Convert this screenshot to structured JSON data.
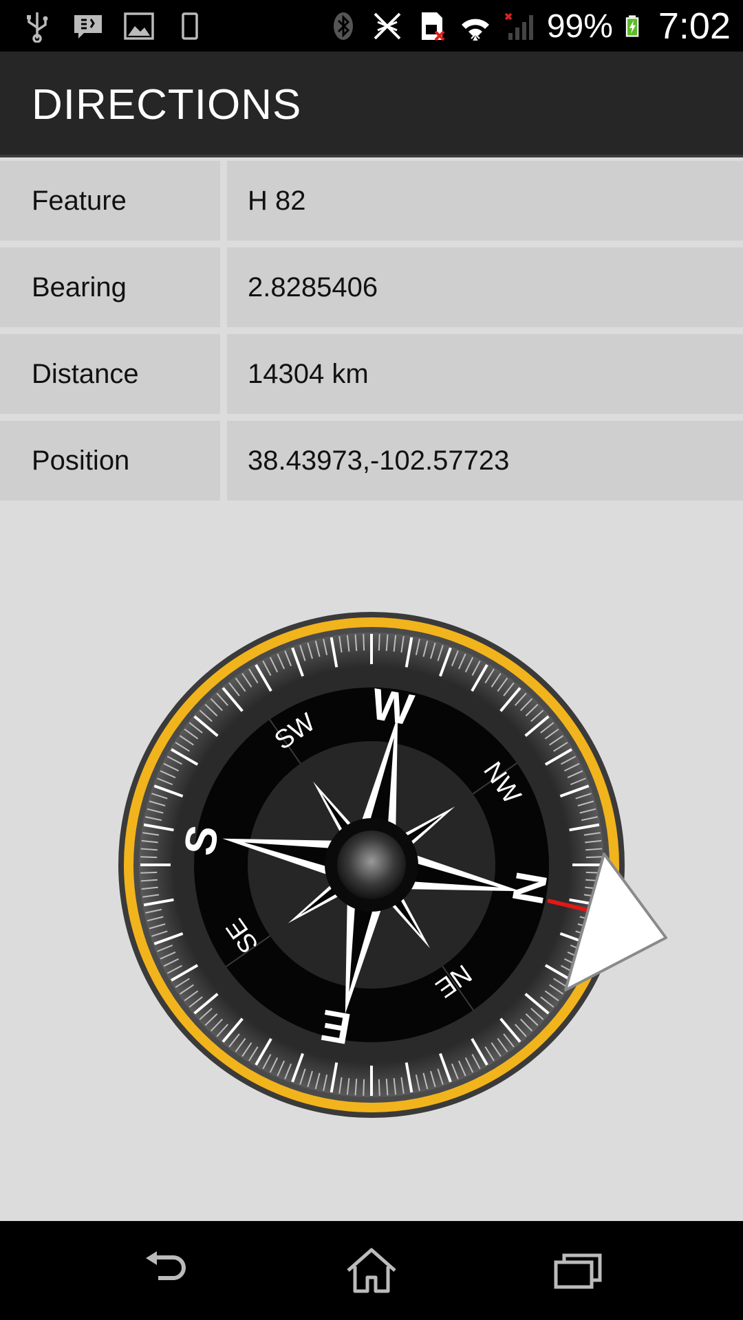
{
  "status_bar": {
    "battery": "99%",
    "time": "7:02",
    "left_icons": [
      "usb-icon",
      "notification-icon",
      "image-icon",
      "phone-icon"
    ],
    "right_icons": [
      "bluetooth-icon",
      "nfc-off-icon",
      "sim-error-icon",
      "wifi-icon",
      "signal-icon",
      "battery-charging-icon"
    ]
  },
  "action_bar": {
    "title": "DIRECTIONS"
  },
  "details": [
    {
      "label": "Feature",
      "value": "H 82"
    },
    {
      "label": "Bearing",
      "value": "2.8285406"
    },
    {
      "label": "Distance",
      "value": "14304 km"
    },
    {
      "label": "Position",
      "value": "38.43973,-102.57723"
    }
  ],
  "compass": {
    "labels": {
      "n": "N",
      "s": "S",
      "e": "E",
      "w": "W",
      "ne": "NE",
      "nw": "NW",
      "se": "SE",
      "sw": "SW"
    },
    "ring_color": "#f2b41c",
    "needle_color": "#e01818"
  },
  "nav_bar": {
    "icons": [
      "back-icon",
      "home-icon",
      "recent-apps-icon"
    ]
  }
}
